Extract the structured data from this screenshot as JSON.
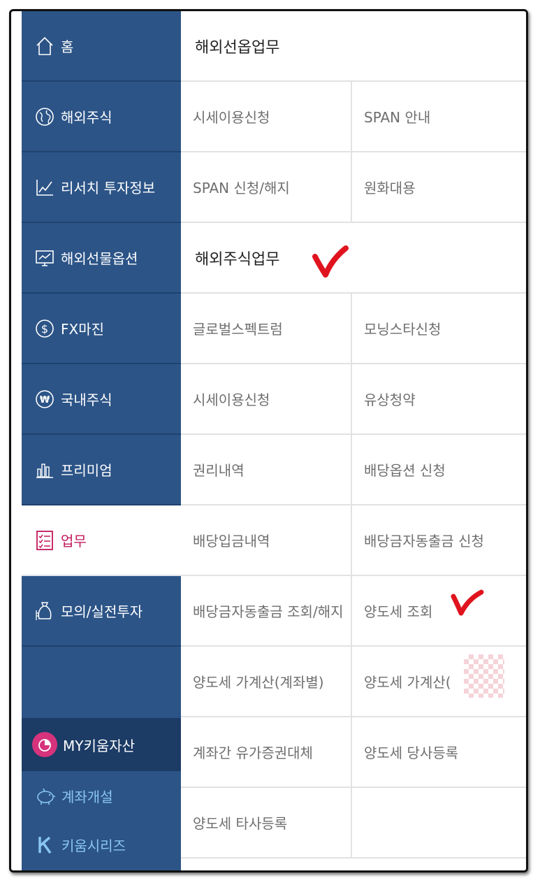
{
  "sidebar": {
    "items": [
      {
        "label": "홈",
        "icon": "home-icon"
      },
      {
        "label": "해외주식",
        "icon": "globe-icon"
      },
      {
        "label": "리서치 투자정보",
        "icon": "line-chart-icon"
      },
      {
        "label": "해외선물옵션",
        "icon": "monitor-chart-icon"
      },
      {
        "label": "FX마진",
        "icon": "dollar-circle-icon"
      },
      {
        "label": "국내주식",
        "icon": "won-circle-icon"
      },
      {
        "label": "프리미엄",
        "icon": "bar-chart-icon"
      },
      {
        "label": "업무",
        "icon": "checklist-icon",
        "active": true
      },
      {
        "label": "모의/실전투자",
        "icon": "money-bag-icon"
      }
    ],
    "my_asset": {
      "label": "MY키움자산",
      "icon": "pie-chart-icon"
    },
    "account_open": {
      "label": "계좌개설",
      "icon": "piggy-bank-icon"
    },
    "kiwoom_series": {
      "label": "키움시리즈",
      "icon": "kiwoom-k-icon"
    }
  },
  "content": {
    "futures_section": {
      "title": "해외선옵업무",
      "rows": [
        [
          "시세이용신청",
          "SPAN 안내"
        ],
        [
          "SPAN 신청/해지",
          "원화대용"
        ]
      ]
    },
    "stocks_section": {
      "title": "해외주식업무",
      "rows": [
        [
          "글로벌스펙트럼",
          "모닝스타신청"
        ],
        [
          "시세이용신청",
          "유상청약"
        ],
        [
          "권리내역",
          "배당옵션 신청"
        ],
        [
          "배당입금내역",
          "배당금자동출금 신청"
        ],
        [
          "배당금자동출금 조회/해지",
          "양도세 조회"
        ],
        [
          "양도세 가계산(계좌별)",
          "양도세 가계산("
        ],
        [
          "계좌간 유가증권대체",
          "양도세 당사등록"
        ],
        [
          "양도세 타사등록",
          ""
        ]
      ]
    }
  },
  "colors": {
    "sidebar_bg": "#2c5487",
    "active_text": "#c2185b",
    "sub_link": "#8ac6ef",
    "check_mark": "#e0141e"
  }
}
